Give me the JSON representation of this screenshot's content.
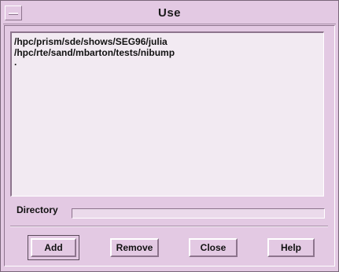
{
  "window": {
    "title": "Use"
  },
  "list": {
    "items": [
      "/hpc/prism/sde/shows/SEG96/julia",
      "/hpc/rte/sand/mbarton/tests/nibump",
      "."
    ]
  },
  "directory": {
    "label": "Directory",
    "value": ""
  },
  "buttons": {
    "add": "Add",
    "remove": "Remove",
    "close": "Close",
    "help": "Help"
  },
  "colors": {
    "background": "#e3c9e3",
    "list_background": "#f2eaf2"
  }
}
